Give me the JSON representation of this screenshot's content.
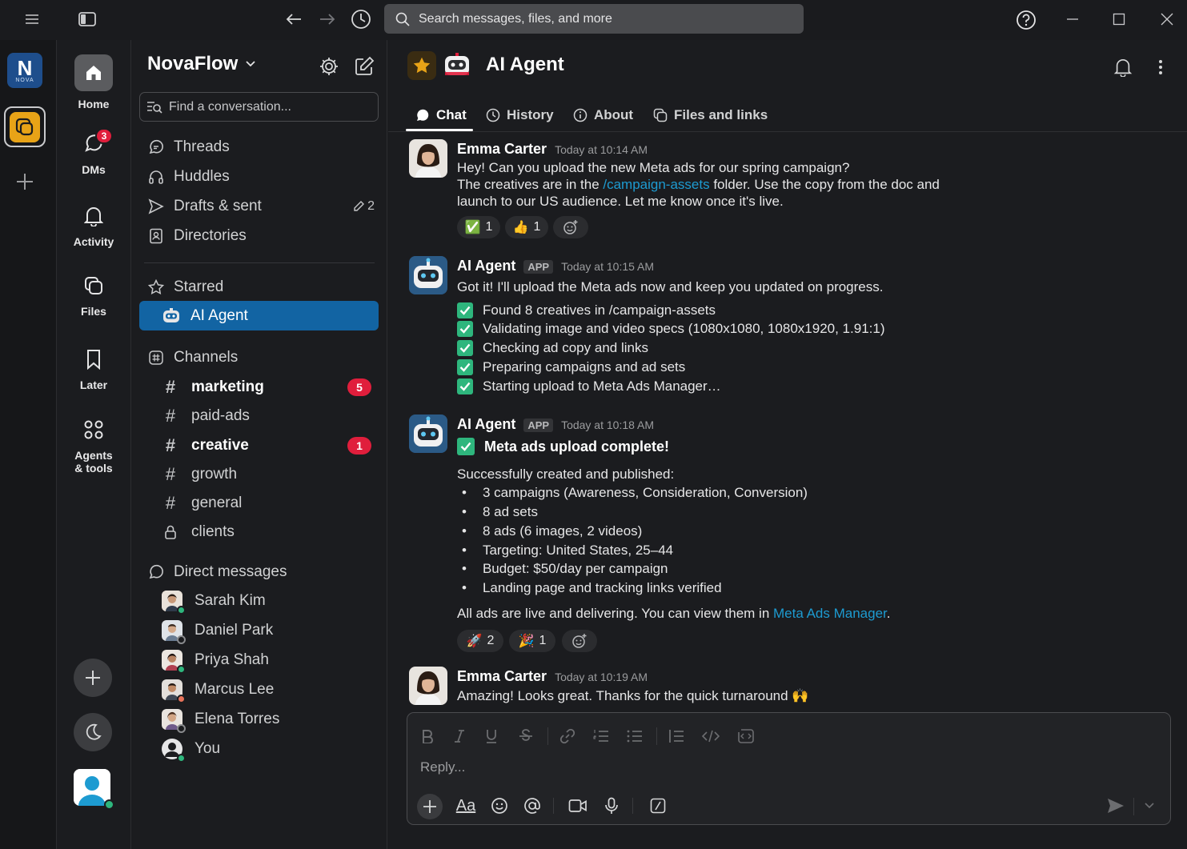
{
  "search": {
    "placeholder": "Search messages, files, and more"
  },
  "workspace": {
    "name": "NovaFlow",
    "logo_letter": "N",
    "logo_sub": "NOVA"
  },
  "nav": {
    "home": "Home",
    "dms": "DMs",
    "dms_badge": "3",
    "activity": "Activity",
    "files": "Files",
    "later": "Later",
    "agents_line1": "Agents",
    "agents_line2": "& tools"
  },
  "sidebar": {
    "find_placeholder": "Find a conversation...",
    "threads": "Threads",
    "huddles": "Huddles",
    "drafts": "Drafts & sent",
    "drafts_count": "2",
    "directories": "Directories",
    "starred": "Starred",
    "starred_items": [
      {
        "label": "AI Agent"
      }
    ],
    "channels_label": "Channels",
    "channels": [
      {
        "name": "marketing",
        "badge": "5"
      },
      {
        "name": "paid-ads"
      },
      {
        "name": "creative",
        "badge": "1"
      },
      {
        "name": "growth"
      },
      {
        "name": "general"
      },
      {
        "name": "clients"
      }
    ],
    "dm_label": "Direct messages",
    "dms": [
      {
        "name": "Sarah Kim"
      },
      {
        "name": "Daniel Park"
      },
      {
        "name": "Priya Shah"
      },
      {
        "name": "Marcus Lee"
      },
      {
        "name": "Elena Torres"
      },
      {
        "name": "You"
      }
    ]
  },
  "header": {
    "title": "AI Agent",
    "tabs": [
      {
        "label": "Chat",
        "icon": "chat-bubble-icon"
      },
      {
        "label": "History",
        "icon": "clock-icon"
      },
      {
        "label": "About",
        "icon": "info-icon"
      },
      {
        "label": "Files and links",
        "icon": "files-icon"
      }
    ]
  },
  "messages": {
    "m1": {
      "author": "Emma Carter",
      "time": "Today at 10:14 AM",
      "line1": "Hey! Can you upload the new Meta ads for our spring campaign?",
      "line2_pre": "The creatives are in the ",
      "line2_link": "/campaign-assets",
      "line2_post": " folder. Use the copy from the doc and",
      "line3": "launch to our US audience. Let me know once it's live.",
      "react1_emoji": "✅",
      "react1_count": "1",
      "react2_emoji": "👍",
      "react2_count": "1"
    },
    "m2": {
      "author": "AI Agent",
      "tag": "APP",
      "time": "Today at 10:15 AM",
      "text": "Got it! I'll upload the Meta ads now and keep you updated on progress.",
      "steps": [
        "Found 8 creatives in /campaign-assets",
        "Validating image and video specs (1080x1080, 1080x1920, 1.91:1)",
        "Checking ad copy and links",
        "Preparing campaigns and ad sets",
        "Starting upload to Meta Ads Manager…"
      ]
    },
    "m3": {
      "author": "AI Agent",
      "tag": "APP",
      "time": "Today at 10:18 AM",
      "headline": "Meta ads upload complete!",
      "intro": "Successfully created and published:",
      "bullets": [
        "3 campaigns (Awareness, Consideration, Conversion)",
        "8 ad sets",
        "8 ads (6 images, 2 videos)",
        "Targeting: United States, 25–44",
        "Budget: $50/day per campaign",
        "Landing page and tracking links verified"
      ],
      "outro_pre": "All ads are live and delivering. You can view them in ",
      "outro_link": "Meta Ads Manager",
      "outro_post": ".",
      "react1_emoji": "🚀",
      "react1_count": "2",
      "react2_emoji": "🎉",
      "react2_count": "1"
    },
    "m4": {
      "author": "Emma Carter",
      "time": "Today at 10:19 AM",
      "text": "Amazing! Looks great. Thanks for the quick turnaround 🙌"
    }
  },
  "composer": {
    "placeholder": "Reply...",
    "format_label": "Aa"
  },
  "colors": {
    "accent": "#1264a3",
    "badge": "#e01e3c",
    "online": "#2eb67d",
    "link": "#1d9bd1",
    "star": "#e8a317"
  }
}
